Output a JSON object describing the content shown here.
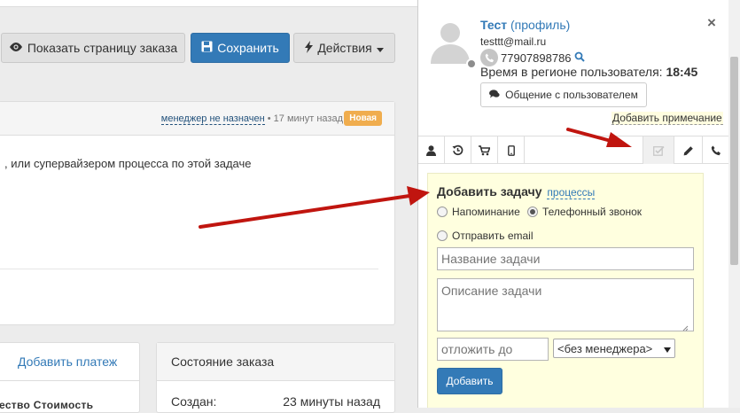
{
  "toolbar": {
    "show_order_page_label": "Показать страницу заказа",
    "save_label": "Сохранить",
    "actions_label": "Действия"
  },
  "order": {
    "manager_link": "менеджер не назначен",
    "meta_suffix": " • 17 минут назад",
    "badge": "Новая",
    "text": ", или супервайзером процесса по этой задаче"
  },
  "payments": {
    "add_payment_label": "Добавить платеж",
    "columns_partial": "ество    Стоимость"
  },
  "order_state": {
    "title": "Состояние заказа",
    "created_label": "Создан:",
    "created_value": "23 минуты назад"
  },
  "user": {
    "name": "Тест",
    "profile_link": "(профиль)",
    "email": "testtt@mail.ru",
    "phone": "77907898786",
    "region_time_label": "Время в регионе пользователя: ",
    "region_time_value": "18:45",
    "chat_button_label": "Общение с пользователем",
    "add_note_label": "Добавить примечание"
  },
  "tabs": [
    {
      "icon": "user-icon"
    },
    {
      "icon": "history-icon"
    },
    {
      "icon": "cart-icon"
    },
    {
      "icon": "mobile-icon"
    },
    {
      "icon": "task-icon",
      "active": true
    },
    {
      "icon": "pencil-icon"
    },
    {
      "icon": "phone-icon"
    }
  ],
  "task_form": {
    "heading": "Добавить задачу",
    "processes_link": "процессы",
    "radio_reminder": "Напоминание",
    "radio_phone_call": "Телефонный звонок",
    "radio_email": "Отправить email",
    "selected_radio": "Телефонный звонок",
    "title_placeholder": "Название задачи",
    "description_placeholder": "Описание задачи",
    "postpone_placeholder": "отложить до",
    "manager_select_value": "<без менеджера>",
    "add_button_label": "Добавить"
  },
  "colors": {
    "primary": "#337ab7",
    "badge_orange": "#f0ad4e",
    "task_box_bg": "#ffffdf",
    "arrow": "#c0150f"
  }
}
